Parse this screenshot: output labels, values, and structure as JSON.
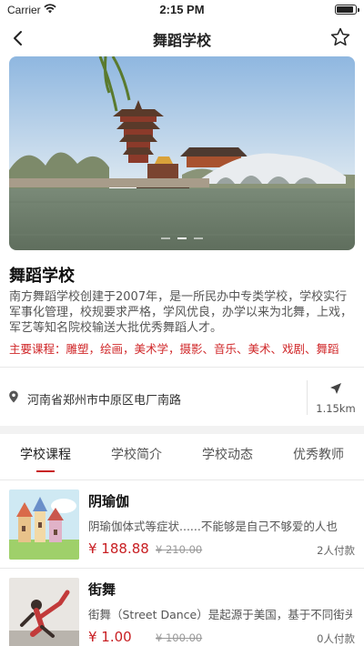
{
  "status_bar": {
    "carrier": "Carrier",
    "time": "2:15 PM"
  },
  "nav": {
    "title": "舞蹈学校"
  },
  "school": {
    "name": "舞蹈学校",
    "intro": "南方舞蹈学校创建于2007年，是一所民办中专类学校，学校实行军事化管理，校规要求严格，学风优良，办学以来为北舞，上戏，军艺等知名院校输送大批优秀舞蹈人才。",
    "courses_line": "主要课程：雕塑，绘画，美术学，摄影、音乐、美术、戏剧、舞蹈"
  },
  "location": {
    "address": "河南省郑州市中原区电厂南路",
    "distance": "1.15km"
  },
  "tabs": [
    {
      "label": "学校课程",
      "active": true
    },
    {
      "label": "学校简介",
      "active": false
    },
    {
      "label": "学校动态",
      "active": false
    },
    {
      "label": "优秀教师",
      "active": false
    }
  ],
  "course_list": [
    {
      "name": "阴瑜伽",
      "desc": "阴瑜伽体式等症状......不能够是自己不够爱的人也",
      "price": "¥ 188.88",
      "original_price": "¥ 210.00",
      "paid": "2人付款"
    },
    {
      "name": "街舞",
      "desc": "街舞（Street Dance）是起源于美国，基于不同街头文化",
      "price": "¥ 1.00",
      "original_price": "¥ 100.00",
      "paid": "0人付款"
    }
  ],
  "colors": {
    "accent": "#c81e22",
    "course_text": "#d0282a"
  },
  "icons": {
    "back": "chevron-left-icon",
    "favorite": "star-outline-icon",
    "location": "location-pin-icon",
    "navigate": "navigation-arrow-icon"
  }
}
